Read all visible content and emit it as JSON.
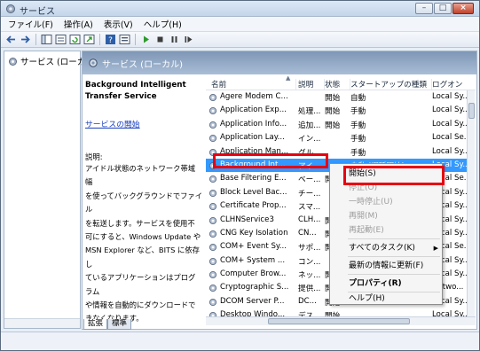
{
  "window": {
    "title": "サービス",
    "btn_min": "–",
    "btn_max": "□",
    "btn_close": "×"
  },
  "menu": [
    "ファイル(F)",
    "操作(A)",
    "表示(V)",
    "ヘルプ(H)"
  ],
  "toolbar_icons": [
    "back-icon",
    "forward-icon",
    "show-hide-tree-icon",
    "console-view-icon",
    "refresh-icon",
    "export-list-icon",
    "help-icon",
    "properties-icon",
    "play-icon",
    "stop-icon",
    "pause-icon",
    "restart-icon"
  ],
  "tree": {
    "item": "サービス (ローカ"
  },
  "main": {
    "header": "サービス (ローカル)",
    "service_name_line1": "Background Intelligent",
    "service_name_line2": "Transfer Service",
    "start_link": "サービスの開始",
    "desc_label": "説明:",
    "desc_lines": [
      "アイドル状態のネットワーク帯域幅",
      "を使ってバックグラウンドでファイル",
      "を転送します。サービスを使用不",
      "可にすると、Windows Update や",
      "MSN Explorer など、BITS に依存し",
      "ているアプリケーションはプログラム",
      "や情報を自動的にダウンロードで",
      "きなくなります。"
    ]
  },
  "columns": {
    "name": "名前",
    "desc": "説明",
    "status": "状態",
    "startup": "スタートアップの種類",
    "logon": "ログオン"
  },
  "services": [
    {
      "name": "Agere Modem C...",
      "desc": "",
      "status": "開始",
      "startup": "自動",
      "logon": "Local Sy..."
    },
    {
      "name": "Application Exp...",
      "desc": "処理...",
      "status": "開始",
      "startup": "手動",
      "logon": "Local Sy..."
    },
    {
      "name": "Application Info...",
      "desc": "追加...",
      "status": "開始",
      "startup": "手動",
      "logon": "Local Sy..."
    },
    {
      "name": "Application Lay...",
      "desc": "イン...",
      "status": "",
      "startup": "手動",
      "logon": "Local Se..."
    },
    {
      "name": "Application Man...",
      "desc": "グル...",
      "status": "",
      "startup": "手動",
      "logon": "Local Sy..."
    },
    {
      "name": "Background Int...",
      "desc": "アイ...",
      "status": "",
      "startup": "自動 (遅延開始)",
      "logon": "Local Sy..."
    },
    {
      "name": "Base Filtering E...",
      "desc": "ベー...",
      "status": "開始",
      "startup": "",
      "logon": "Local Se..."
    },
    {
      "name": "Block Level Bac...",
      "desc": "チー...",
      "status": "",
      "startup": "",
      "logon": "Local Sy..."
    },
    {
      "name": "Certificate Prop...",
      "desc": "スマ...",
      "status": "",
      "startup": "",
      "logon": "Local Sy..."
    },
    {
      "name": "CLHNService3",
      "desc": "CLH...",
      "status": "開始",
      "startup": "",
      "logon": "Local Sy..."
    },
    {
      "name": "CNG Key Isolation",
      "desc": "CN...",
      "status": "開始",
      "startup": "",
      "logon": "Local Sy..."
    },
    {
      "name": "COM+ Event Sy...",
      "desc": "サポ...",
      "status": "開始",
      "startup": "",
      "logon": "Local Se..."
    },
    {
      "name": "COM+ System ...",
      "desc": "コン...",
      "status": "",
      "startup": "",
      "logon": "Local Sy..."
    },
    {
      "name": "Computer Brow...",
      "desc": "ネッ...",
      "status": "開始",
      "startup": "",
      "logon": "Local Sy..."
    },
    {
      "name": "Cryptographic S...",
      "desc": "提供...",
      "status": "開始",
      "startup": "",
      "logon": "Netwo..."
    },
    {
      "name": "DCOM Server P...",
      "desc": "DC...",
      "status": "開始",
      "startup": "",
      "logon": "Local Sy..."
    },
    {
      "name": "Desktop Windo...",
      "desc": "デス...",
      "status": "開始",
      "startup": "",
      "logon": "Local Sy..."
    }
  ],
  "tabs": {
    "extended": "拡張",
    "standard": "標準"
  },
  "context_menu": {
    "start": "開始(S)",
    "stop": "停止(O)",
    "pause": "一時停止(U)",
    "resume": "再開(M)",
    "restart": "再起動(E)",
    "all_tasks": "すべてのタスク(K)",
    "refresh": "最新の情報に更新(F)",
    "properties": "プロパティ(R)",
    "help": "ヘルプ(H)"
  },
  "highlight_color": "#e60012",
  "selection_color": "#3399ff"
}
